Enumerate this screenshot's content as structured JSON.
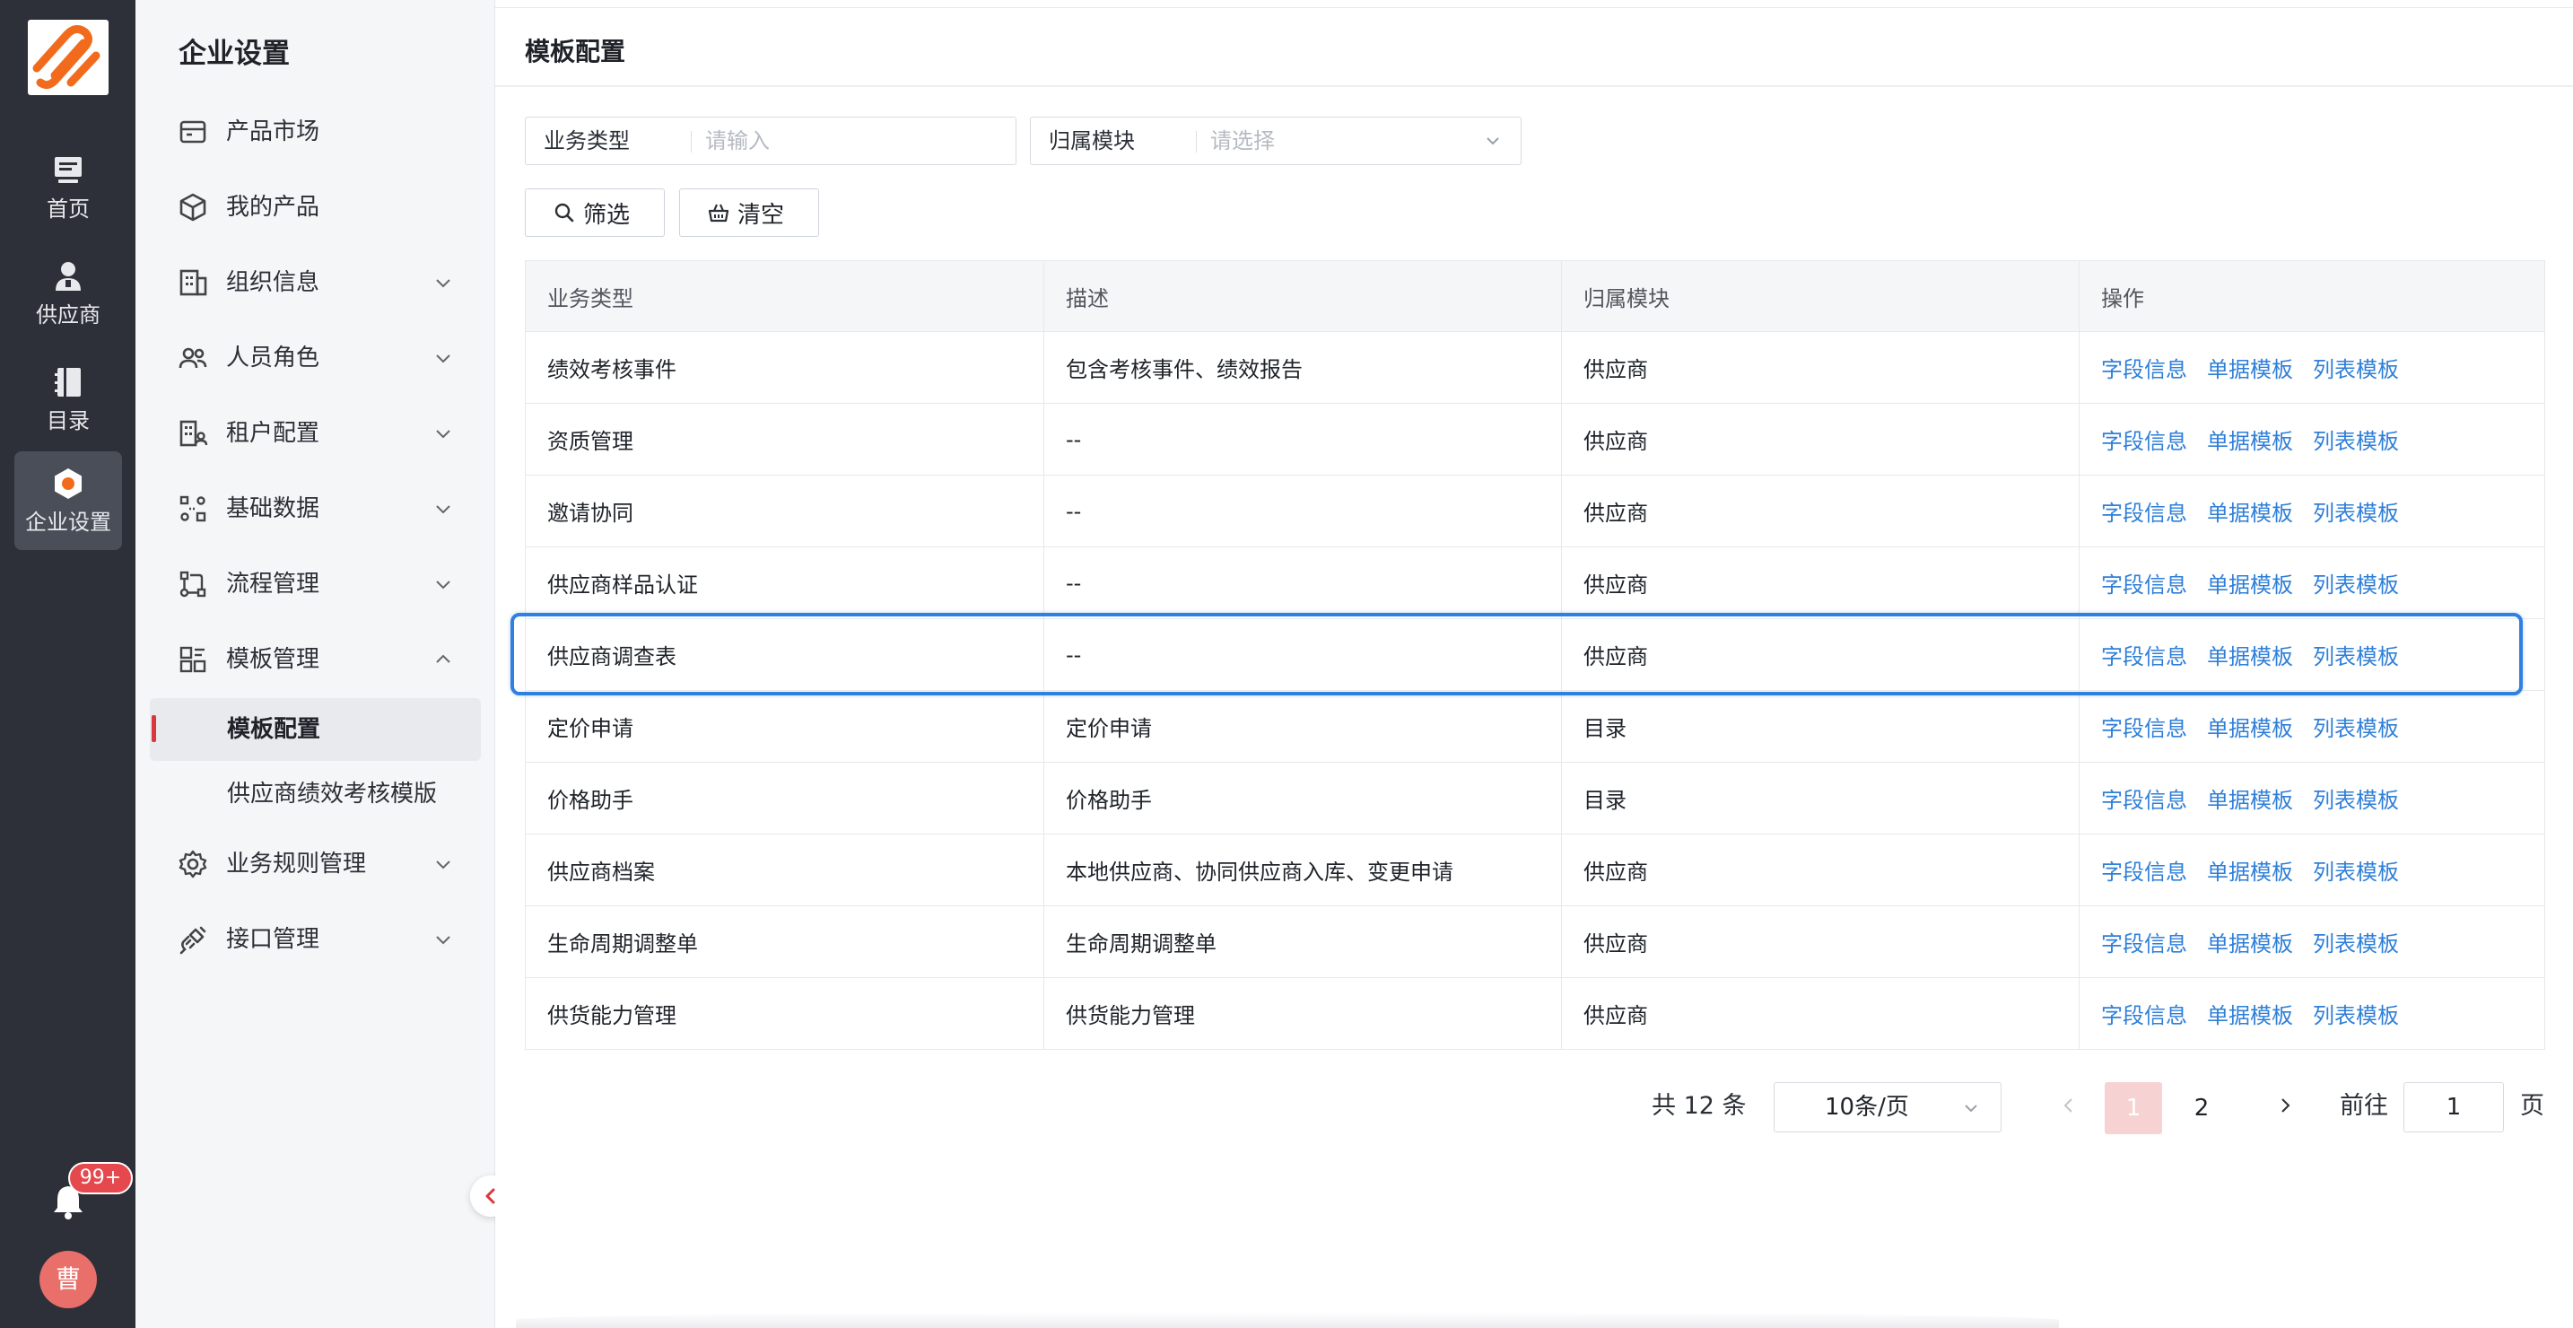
{
  "rail": {
    "items": [
      {
        "label": "首页",
        "icon": "monitor-icon",
        "active": false
      },
      {
        "label": "供应商",
        "icon": "person-icon",
        "active": false
      },
      {
        "label": "目录",
        "icon": "catalog-icon",
        "active": false
      },
      {
        "label": "企业设置",
        "icon": "settings-hex-icon",
        "active": true
      }
    ],
    "notification_badge": "99+",
    "avatar_text": "曹"
  },
  "menu": {
    "title": "企业设置",
    "items": [
      {
        "label": "产品市场",
        "icon": "storefront-icon"
      },
      {
        "label": "我的产品",
        "icon": "cube-icon"
      },
      {
        "label": "组织信息",
        "icon": "building-icon"
      },
      {
        "label": "人员角色",
        "icon": "people-icon"
      },
      {
        "label": "租户配置",
        "icon": "tenant-icon"
      },
      {
        "label": "基础数据",
        "icon": "nodes-icon"
      },
      {
        "label": "流程管理",
        "icon": "flow-icon"
      },
      {
        "label": "模板管理",
        "icon": "template-icon"
      },
      {
        "label": "业务规则管理",
        "icon": "gear-icon"
      },
      {
        "label": "接口管理",
        "icon": "plug-icon"
      }
    ],
    "sub_items": [
      {
        "label": "模板配置",
        "active": true
      },
      {
        "label": "供应商绩效考核模版",
        "active": false
      }
    ]
  },
  "page": {
    "title": "模板配置",
    "filters": {
      "business_type": {
        "label": "业务类型",
        "placeholder": "请输入"
      },
      "module": {
        "label": "归属模块",
        "placeholder": "请选择"
      }
    },
    "buttons": {
      "filter": "筛选",
      "clear": "清空"
    }
  },
  "table": {
    "columns": [
      "业务类型",
      "描述",
      "归属模块",
      "操作"
    ],
    "actions": [
      "字段信息",
      "单据模板",
      "列表模板"
    ],
    "rows": [
      {
        "type": "绩效考核事件",
        "desc": "包含考核事件、绩效报告",
        "module": "供应商"
      },
      {
        "type": "资质管理",
        "desc": "--",
        "module": "供应商"
      },
      {
        "type": "邀请协同",
        "desc": "--",
        "module": "供应商"
      },
      {
        "type": "供应商样品认证",
        "desc": "--",
        "module": "供应商"
      },
      {
        "type": "供应商调查表",
        "desc": "--",
        "module": "供应商"
      },
      {
        "type": "定价申请",
        "desc": "定价申请",
        "module": "目录"
      },
      {
        "type": "价格助手",
        "desc": "价格助手",
        "module": "目录"
      },
      {
        "type": "供应商档案",
        "desc": "本地供应商、协同供应商入库、变更申请",
        "module": "供应商"
      },
      {
        "type": "生命周期调整单",
        "desc": "生命周期调整单",
        "module": "供应商"
      },
      {
        "type": "供货能力管理",
        "desc": "供货能力管理",
        "module": "供应商"
      }
    ]
  },
  "pagination": {
    "total": "共 12 条",
    "page_size": "10条/页",
    "pages": [
      "1",
      "2"
    ],
    "current": "1",
    "goto_prefix": "前往",
    "goto_value": "1",
    "goto_suffix": "页"
  },
  "colors": {
    "rail_bg": "#2d3039",
    "link": "#2f7fd8",
    "active_marker": "#d9363e",
    "highlight": "#2f80e0",
    "badge": "#e5484d",
    "logo_orange": "#f26b1d"
  }
}
